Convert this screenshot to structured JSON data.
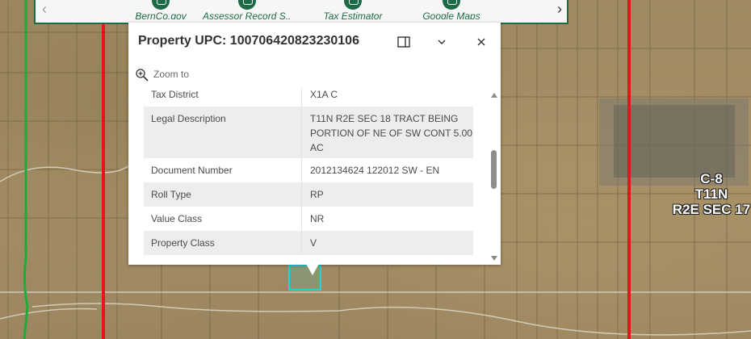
{
  "carousel": {
    "items": [
      {
        "label": "BernCo.gov"
      },
      {
        "label": "Assessor Record S..."
      },
      {
        "label": "Tax Estimator"
      },
      {
        "label": "Google Maps"
      }
    ]
  },
  "map": {
    "parcel_label": [
      "C-8",
      "T11N",
      "R2E SEC 17"
    ]
  },
  "popup": {
    "title": "Property UPC: 100706420823230106",
    "zoom_label": "Zoom to",
    "rows": [
      {
        "key": "Tax District",
        "value": "X1A C"
      },
      {
        "key": "Legal Description",
        "value": "T11N R2E SEC 18 TRACT BEING PORTION OF NE OF SW CONT 5.00 AC"
      },
      {
        "key": "Document Number",
        "value": "2012134624 122012 SW - EN"
      },
      {
        "key": "Roll Type",
        "value": "RP"
      },
      {
        "key": "Value Class",
        "value": "NR"
      },
      {
        "key": "Property Class",
        "value": "V"
      }
    ]
  },
  "colors": {
    "accent": "#1b6b46",
    "road_red": "#e8141c",
    "road_green": "#1faa3a",
    "selection": "#1ed6d6"
  }
}
